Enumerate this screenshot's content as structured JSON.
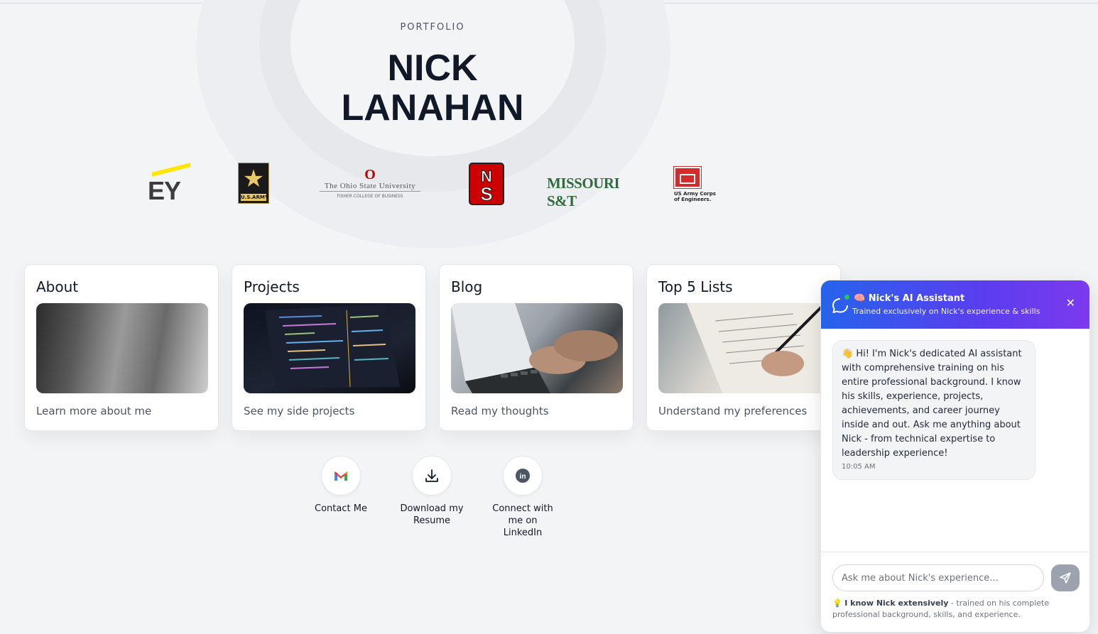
{
  "header": {
    "eyebrow": "PORTFOLIO",
    "name_line1": "NICK",
    "name_line2": "LANAHAN"
  },
  "logos": {
    "ey": "EY",
    "army_label": "U.S.ARMY",
    "osu_line1": "The Ohio State University",
    "osu_line2": "FISHER COLLEGE OF BUSINESS",
    "missouri": "MISSOURI S&T",
    "usace": "US Army Corps of Engineers."
  },
  "cards": [
    {
      "title": "About",
      "desc": "Learn more about me"
    },
    {
      "title": "Projects",
      "desc": "See my side projects"
    },
    {
      "title": "Blog",
      "desc": "Read my thoughts"
    },
    {
      "title": "Top 5 Lists",
      "desc": "Understand my preferences"
    }
  ],
  "actions": [
    {
      "label": "Contact Me",
      "icon": "gmail-icon"
    },
    {
      "label": "Download my Resume",
      "icon": "download-icon"
    },
    {
      "label": "Connect with me on LinkedIn",
      "icon": "linkedin-icon"
    }
  ],
  "chat": {
    "title": "🧠 Nick's AI Assistant",
    "subtitle": "Trained exclusively on Nick's experience & skills",
    "message": "👋 Hi! I'm Nick's dedicated AI assistant with comprehensive training on his entire professional background. I know his skills, experience, projects, achievements, and career journey inside and out. Ask me anything about Nick - from technical expertise to leadership experience!",
    "time": "10:05 AM",
    "input_placeholder": "Ask me about Nick's experience...",
    "note_emoji": "💡",
    "note_bold": "I know Nick extensively",
    "note_rest": " - trained on his complete professional background, skills, and experience."
  },
  "colors": {
    "header_start": "#2563eb",
    "header_end": "#7c3aed",
    "ncs_red": "#cc0000",
    "osu_red": "#bb0000",
    "missouri_green": "#2f6b3c"
  }
}
